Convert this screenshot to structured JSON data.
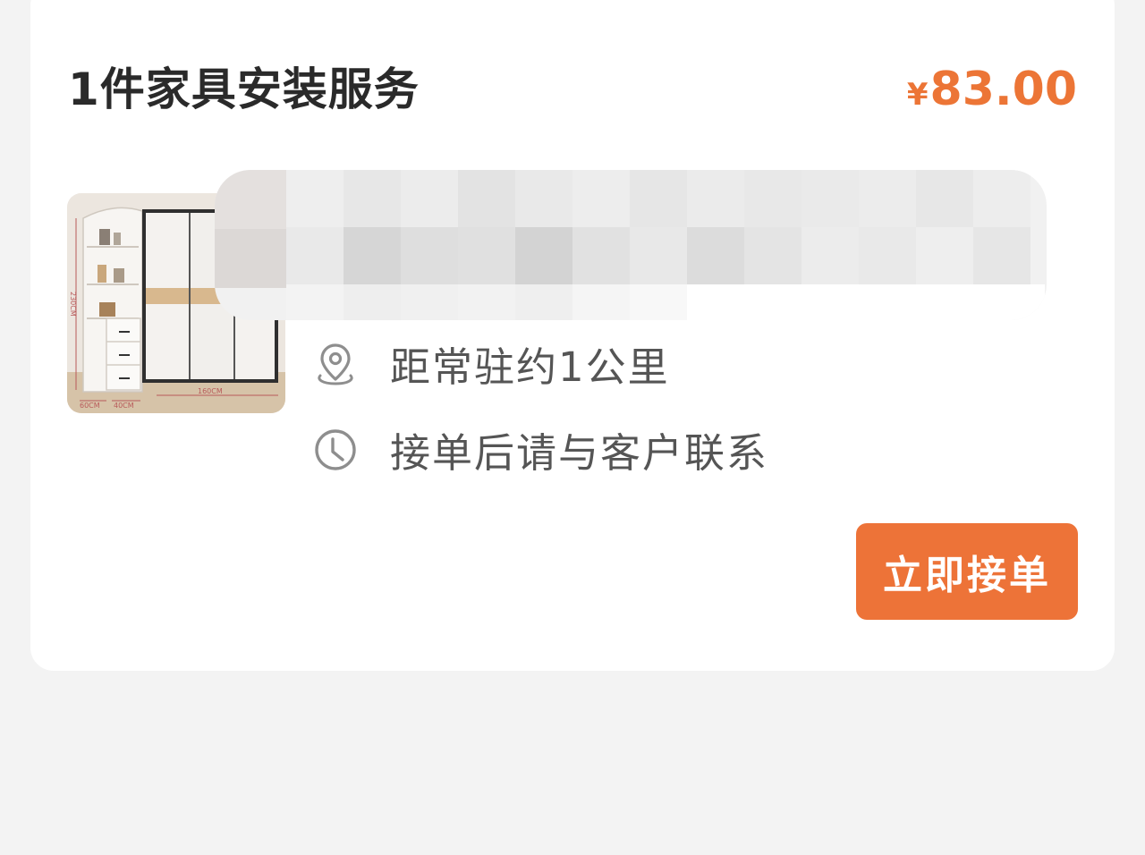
{
  "order": {
    "title": "1件家具安装服务",
    "price_symbol": "¥",
    "price_amount": "83.00",
    "thumbnail": {
      "icon": "wardrobe-image",
      "dimension_labels": [
        "230CM",
        "160CM",
        "60CM",
        "40CM"
      ]
    },
    "info": [
      {
        "icon": "location-pin-icon",
        "text": "距常驻约1公里"
      },
      {
        "icon": "clock-icon",
        "text": "接单后请与客户联系"
      }
    ],
    "accept_label": "立即接单"
  },
  "colors": {
    "accent": "#ec7536",
    "title": "#2a2a2a",
    "info_text": "#555555",
    "page_bg": "#f3f3f3"
  }
}
